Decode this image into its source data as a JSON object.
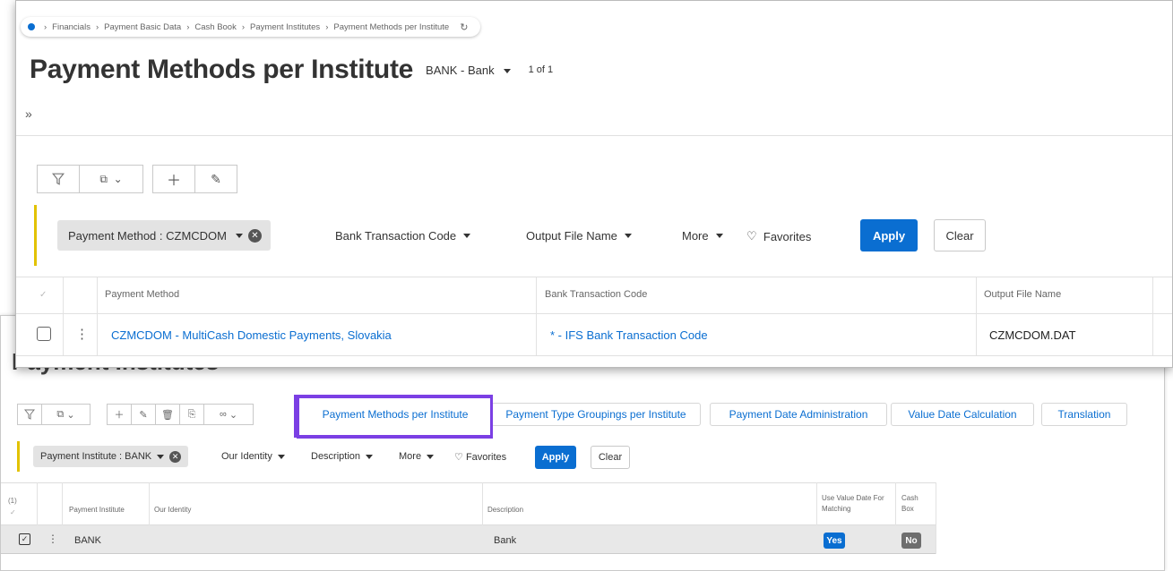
{
  "back_window": {
    "title": "Payment Institutes",
    "toolbar_icons": [
      "filter-icon",
      "export-icon",
      "chevron-down-icon",
      "add-icon",
      "edit-icon",
      "delete-icon",
      "copy-icon",
      "link-icon",
      "chevron-down-icon"
    ],
    "tabs": [
      "Payment Methods per Institute",
      "Payment Type Groupings per Institute",
      "Payment Date Administration",
      "Value Date Calculation",
      "Translation"
    ],
    "filter": {
      "chip": "Payment Institute : BANK",
      "items": [
        "Our Identity",
        "Description",
        "More"
      ],
      "favorites": "Favorites",
      "apply": "Apply",
      "clear": "Clear"
    },
    "table": {
      "select_count": "(1)",
      "headers": [
        "Payment Institute",
        "Our Identity",
        "Description",
        "Use Value Date For Matching",
        "Cash Box"
      ],
      "rows": [
        {
          "payment_institute": "BANK",
          "our_identity": "",
          "description": "Bank",
          "use_value_date": "Yes",
          "cash_box": "No"
        }
      ]
    },
    "colors": {
      "highlight_box": "#7b3fe4",
      "yes_badge": "#0a6ed1",
      "no_badge": "#6e6e6e"
    }
  },
  "front_window": {
    "breadcrumb": [
      "Financials",
      "Payment Basic Data",
      "Cash Book",
      "Payment Institutes",
      "Payment Methods per Institute"
    ],
    "title": "Payment Methods per Institute",
    "context": "BANK - Bank",
    "record_count": "1 of 1",
    "filter": {
      "chip": "Payment Method : CZMCDOM",
      "items": [
        "Bank Transaction Code",
        "Output File Name",
        "More"
      ],
      "favorites": "Favorites",
      "apply": "Apply",
      "clear": "Clear"
    },
    "table": {
      "headers": [
        "Payment Method",
        "Bank Transaction Code",
        "Output File Name"
      ],
      "rows": [
        {
          "payment_method": "CZMCDOM - MultiCash Domestic Payments, Slovakia",
          "bank_transaction_code": "* - IFS Bank Transaction Code",
          "output_file_name": "CZMCDOM.DAT"
        }
      ]
    },
    "colors": {
      "accent": "#0a6ed1",
      "filter_bar_marker": "#e2c200"
    }
  }
}
